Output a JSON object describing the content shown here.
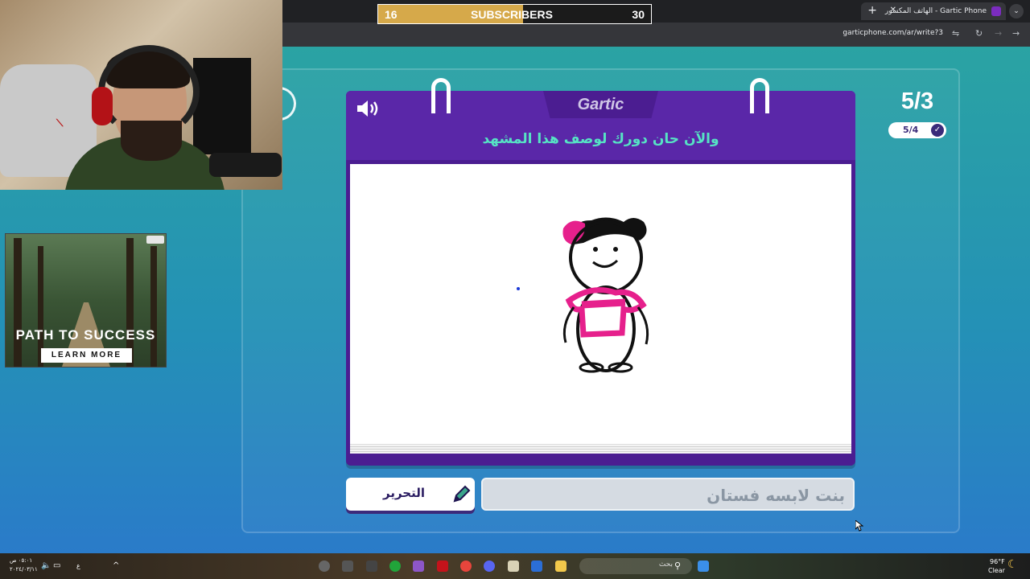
{
  "browser": {
    "tab_title": "Gartic Phone - الهاتف المكسور",
    "url": "garticphone.com/ar/write?3"
  },
  "overlay": {
    "subscribers_label": "SUBSCRIBERS",
    "current_count": "16",
    "goal_count": "30",
    "progress_fraction": 0.53
  },
  "ad": {
    "headline": "PATH TO SUCCESS",
    "cta": "LEARN MORE"
  },
  "game": {
    "logo": "Gartic",
    "prompt": "والآن حان دورك لوصف هذا المشهد",
    "round_display": "5/3",
    "round_pill": "5/4",
    "edit_button": "التحرير",
    "answer_text": "بنت لابسه فستان"
  },
  "taskbar": {
    "search_label": "بحث",
    "weather_temp": "96°F",
    "weather_desc": "Clear",
    "time": "٠٥:٠١ ص",
    "date": "٢٠٢٤/٠٣/١١",
    "lang": "ع"
  },
  "colors": {
    "notebook_purple": "#4b1d91",
    "prompt_teal": "#56e3c4",
    "subscriber_gold": "#d6a94a",
    "drawing_pink": "#e6208c"
  }
}
